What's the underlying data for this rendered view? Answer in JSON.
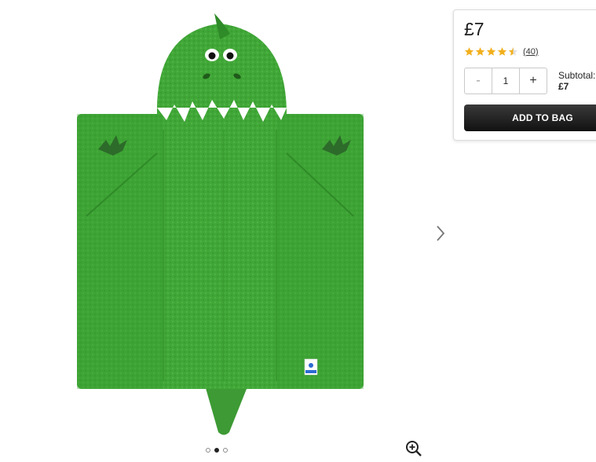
{
  "product": {
    "price": "£7",
    "rating_value": 4.5,
    "rating_max": 5,
    "review_count": "(40)",
    "quantity": "1",
    "minus_label": "-",
    "plus_label": "+",
    "subtotal_label": "Subtotal:",
    "subtotal_value": "£7",
    "add_button_label": "ADD TO BAG"
  },
  "gallery": {
    "image_count": 3,
    "active_index": 1
  },
  "colors": {
    "star": "#f2b01e",
    "button": "#1a1a1a",
    "towel": "#3fa436"
  }
}
